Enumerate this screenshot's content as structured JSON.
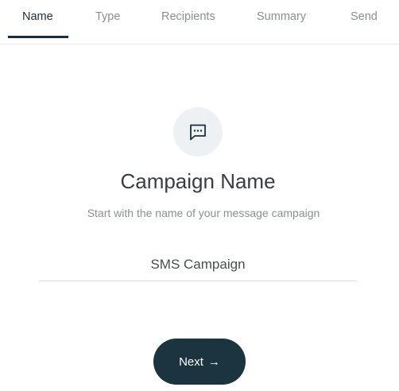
{
  "tabs": [
    {
      "label": "Name",
      "active": true
    },
    {
      "label": "Type",
      "active": false
    },
    {
      "label": "Recipients",
      "active": false
    },
    {
      "label": "Summary",
      "active": false
    },
    {
      "label": "Send",
      "active": false
    }
  ],
  "header": {
    "icon": "message-dots-icon",
    "title": "Campaign Name",
    "subtitle": "Start with the name of your message campaign"
  },
  "form": {
    "campaign_name_value": "SMS Campaign"
  },
  "actions": {
    "next_label": "Next",
    "next_arrow": "→"
  },
  "colors": {
    "primary": "#1c3440",
    "active_tab": "#1c2e38",
    "inactive_tab": "#8a8f93",
    "icon_bg": "#eef1f3"
  }
}
